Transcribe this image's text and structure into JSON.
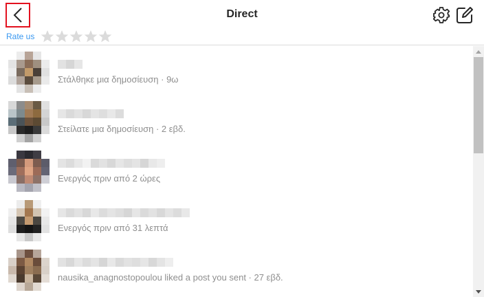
{
  "header": {
    "title": "Direct",
    "back_icon": "chevron-left-icon",
    "settings_icon": "gear-icon",
    "compose_icon": "compose-icon"
  },
  "rating": {
    "label": "Rate us",
    "stars_total": 5,
    "stars_filled": 0
  },
  "colors": {
    "accent_link": "#3897f0",
    "highlight_border": "#e3101e",
    "subtext": "#8e8e8e",
    "star_empty": "#dbdbdb"
  },
  "conversations": [
    {
      "subtext": "Στάλθηκε μια δημοσίευση · 9ω"
    },
    {
      "subtext": "Στείλατε μια δημοσίευση · 2 εβδ."
    },
    {
      "subtext": "Ενεργός πριν από 2 ώρες"
    },
    {
      "subtext": "Ενεργός πριν από 31 λεπτά"
    },
    {
      "subtext": "nausika_anagnostopoulou liked a post you sent · 27 εβδ."
    }
  ]
}
